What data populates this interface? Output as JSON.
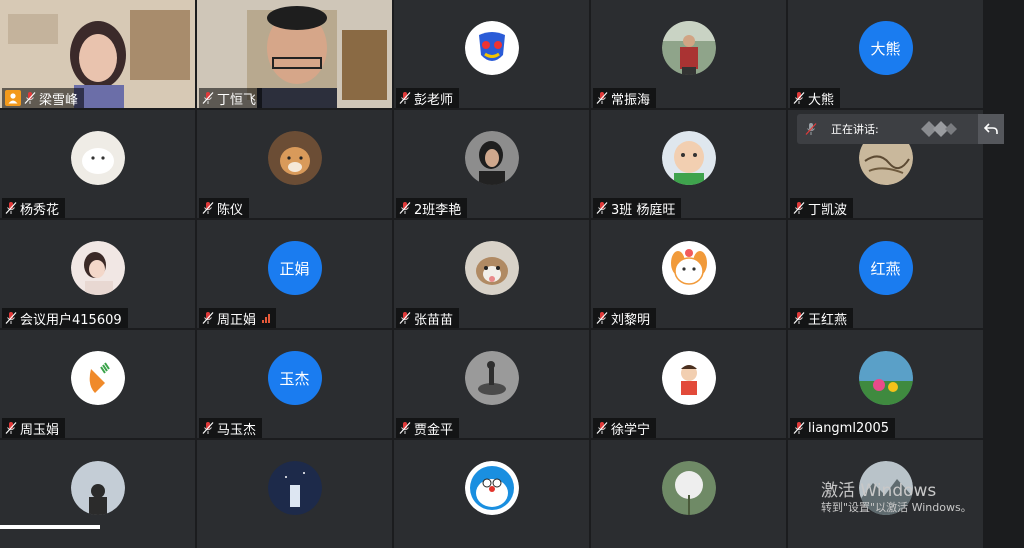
{
  "participants": [
    {
      "name": "梁雪峰",
      "host": true
    },
    {
      "name": "丁恒飞"
    },
    {
      "name": "彭老师"
    },
    {
      "name": "常振海"
    },
    {
      "name": "大熊",
      "avatar_text": "大熊"
    },
    {
      "name": "杨秀花"
    },
    {
      "name": "陈仪"
    },
    {
      "name": "2班李艳"
    },
    {
      "name": "3班  杨庭旺"
    },
    {
      "name": "丁凯波"
    },
    {
      "name": "会议用户415609"
    },
    {
      "name": "周正娟",
      "avatar_text": "正娟"
    },
    {
      "name": "张苗苗"
    },
    {
      "name": "刘黎明"
    },
    {
      "name": "王红燕",
      "avatar_text": "红燕"
    },
    {
      "name": "周玉娟"
    },
    {
      "name": "马玉杰",
      "avatar_text": "玉杰"
    },
    {
      "name": "贾金平"
    },
    {
      "name": "徐学宁"
    },
    {
      "name": "liangml2005"
    }
  ],
  "speaking_panel": {
    "label": "正在讲话:"
  },
  "watermark": {
    "line1": "激活 Windows",
    "line2": "转到\"设置\"以激活 Windows。"
  },
  "icons": {
    "muted": "muted-mic-icon",
    "host": "host-person-icon",
    "signal": "signal-bars-icon",
    "back": "return-arrow-icon"
  },
  "colors": {
    "tile_bg": "#2b2d30",
    "avatar_blue": "#1a7cf0",
    "host_orange": "#f39a1c",
    "mic_red": "#e03a3a"
  }
}
